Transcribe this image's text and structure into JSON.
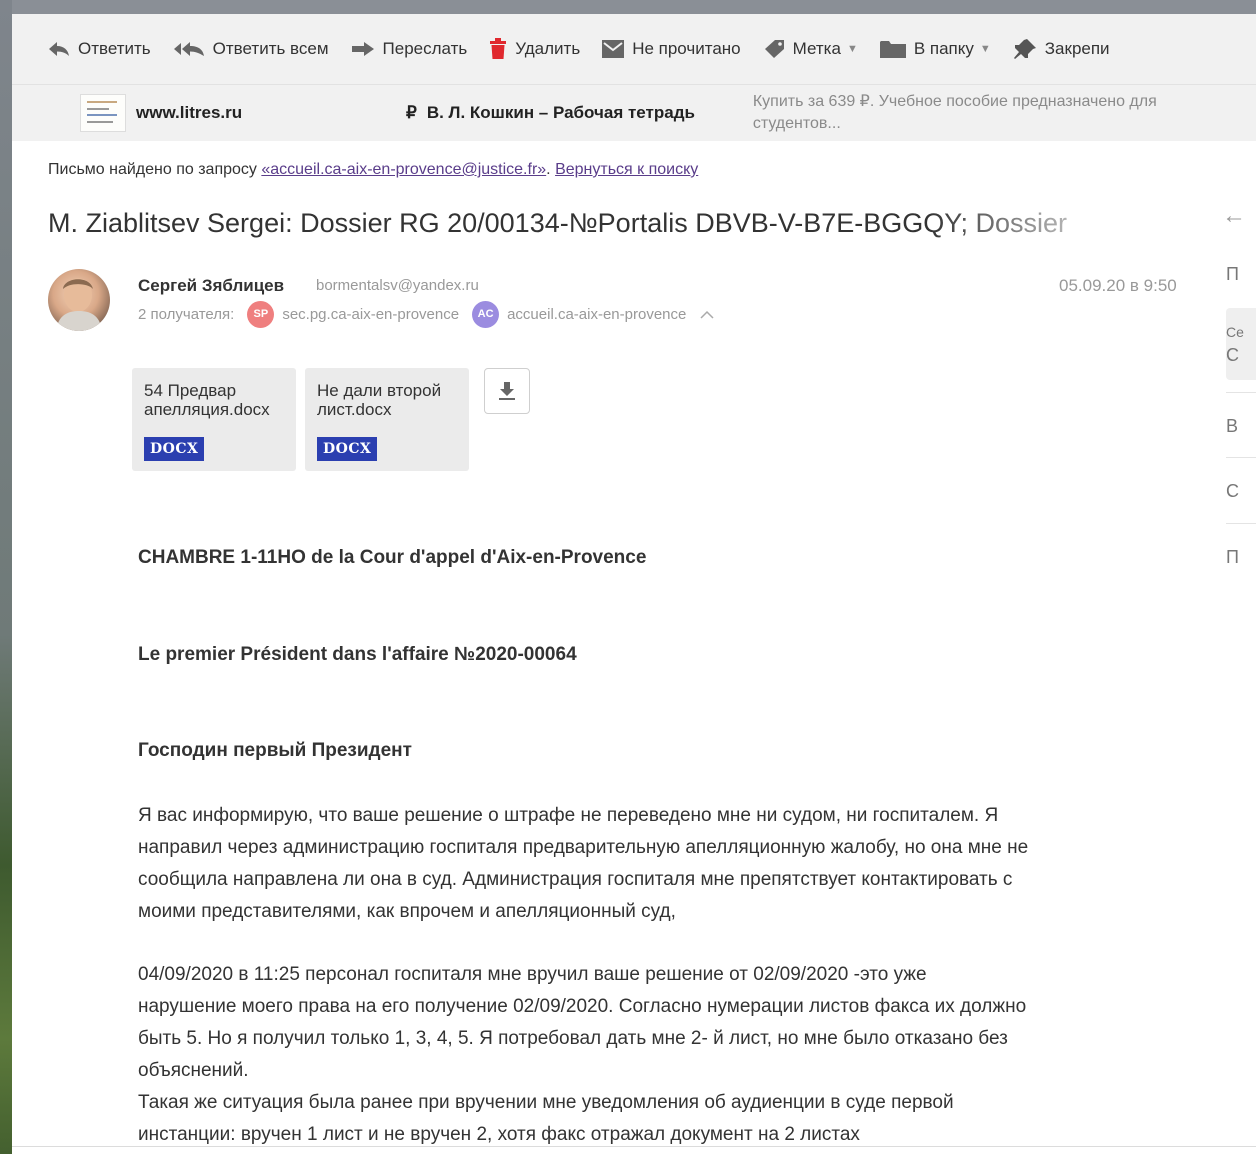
{
  "toolbar": {
    "reply": "Ответить",
    "reply_all": "Ответить всем",
    "forward": "Переслать",
    "delete": "Удалить",
    "unread": "Не прочитано",
    "label": "Метка",
    "move": "В папку",
    "pin": "Закрепи"
  },
  "ad": {
    "site": "www.litres.ru",
    "currency": "₽",
    "title": "В. Л. Кошкин – Рабочая тетрадь",
    "description": "Купить за 639 ₽. Учебное пособие предназначено для студентов..."
  },
  "search_notice": {
    "prefix": "Письмо найдено по запросу ",
    "query": "«accueil.ca-aix-en-provence@justice.fr»",
    "separator": ". ",
    "back_link": "Вернуться к поиску"
  },
  "message": {
    "subject": "M. Ziablitsev Sergei: Dossier RG 20/00134-№Portalis DBVB-V-B7E-BGGQY; Dossier",
    "sender_name": "Сергей Зяблицев",
    "sender_email": "bormentalsv@yandex.ru",
    "recipients_label": "2 получателя:",
    "recipients": [
      {
        "initials": "SP",
        "name": "sec.pg.ca-aix-en-provence",
        "color": "#ef7f7f"
      },
      {
        "initials": "AC",
        "name": "accueil.ca-aix-en-provence",
        "color": "#9b8ce0"
      }
    ],
    "date": "05.09.20 в 9:50"
  },
  "attachments": [
    {
      "name": "54 Предвар апелляция.docx",
      "type": "DOCX"
    },
    {
      "name": "Не дали второй лист.docx",
      "type": "DOCX"
    }
  ],
  "right_pane": {
    "items": [
      "П",
      "Се",
      "С",
      "В",
      "С",
      "П"
    ]
  },
  "body": {
    "heading1": "CHAMBRE 1-11HO de la Cour d'appel d'Aix-en-Provence",
    "heading2": "Le premier Président dans l'affaire №2020-00064",
    "heading3": "Господин первый Президент",
    "para1": [
      "Я вас информирую, что ваше решение о штрафе не переведено мне ни судом,  ни госпиталем.  Я",
      "направил через администрацию госпиталя предварительную апелляционную жалобу, но она мне не",
      "сообщила направлена ли она в суд. Администрация госпиталя мне препятствует контактировать с",
      "моими представителями, как впрочем и апелляционный суд,"
    ],
    "para2": [
      "04/09/2020 в  11:25  персонал госпиталя мне вручил ваше решение от 02/09/2020 -это уже",
      "нарушение моего права на его получение 02/09/2020. Согласно нумерации листов факса их должно",
      "быть 5.  Но я получил только 1, 3, 4, 5.  Я потребовал  дать мне  2- й лист,  но мне было отказано без",
      "объяснений.",
      "Такая же ситуация была ранее при вручении мне уведомления об аудиенции в суде первой",
      "инстанции: вручен 1 лист и не вручен 2, хотя факс отражал документ на 2 листах"
    ]
  }
}
